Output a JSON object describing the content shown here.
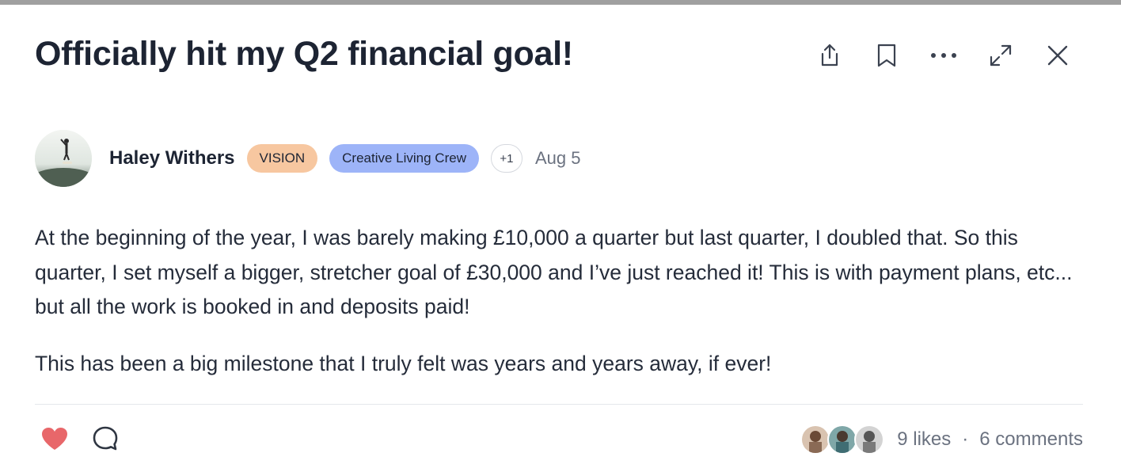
{
  "post": {
    "title": "Officially hit my Q2 financial goal!",
    "author": {
      "name": "Haley Withers",
      "badges": [
        "VISION",
        "Creative Living Crew"
      ],
      "extra_badges": "+1",
      "date": "Aug 5"
    },
    "paragraphs": [
      "At the beginning of the year, I was barely making £10,000 a quarter but last quarter, I doubled that. So this quarter, I set myself a bigger, stretcher goal of £30,000 and I’ve just reached it! This is with payment plans, etc... but all the work is booked in and deposits paid!",
      "This has been a big milestone that I truly felt was years and years away, if ever!"
    ]
  },
  "header_actions": {
    "icons": [
      "share-icon",
      "bookmark-icon",
      "more-options-icon",
      "expand-icon",
      "close-icon"
    ]
  },
  "footer": {
    "likes": "9 likes",
    "separator": "·",
    "comments": "6 comments",
    "icons": [
      "heart-icon",
      "comment-icon"
    ]
  },
  "colors": {
    "vision_badge": "#f7c7a0",
    "crew_badge": "#9db4f8",
    "heart": "#e8676a",
    "title_text": "#1d2433",
    "muted_text": "#6b7280"
  }
}
